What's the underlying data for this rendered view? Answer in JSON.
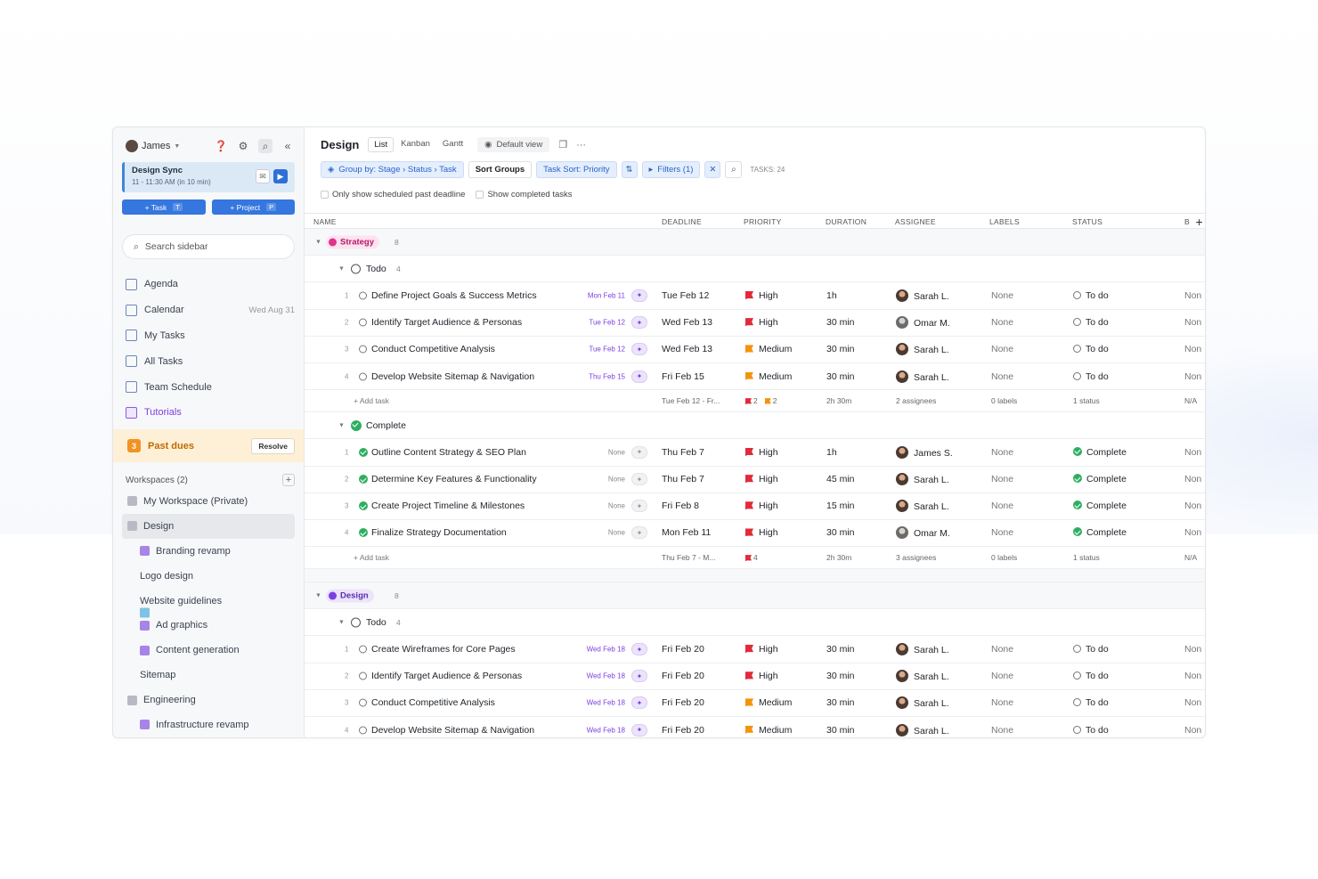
{
  "sidebar": {
    "user": "James",
    "meeting": {
      "title": "Design Sync",
      "time": "11 - 11:30 AM (in 10 min)"
    },
    "task_btn": "+ Task",
    "task_key": "T",
    "project_btn": "+ Project",
    "project_key": "P",
    "search_placeholder": "Search sidebar",
    "nav": [
      {
        "label": "Agenda",
        "extra": ""
      },
      {
        "label": "Calendar",
        "extra": "Wed Aug 31"
      },
      {
        "label": "My Tasks",
        "extra": ""
      },
      {
        "label": "All Tasks",
        "extra": ""
      },
      {
        "label": "Team Schedule",
        "extra": ""
      },
      {
        "label": "Tutorials",
        "extra": ""
      }
    ],
    "past_dues": {
      "count": "3",
      "label": "Past dues",
      "action": "Resolve"
    },
    "workspaces_label": "Workspaces (2)",
    "workspaces": [
      {
        "label": "My Workspace (Private)"
      },
      {
        "label": "Design"
      },
      {
        "label": "Branding revamp"
      },
      {
        "label": "Logo design"
      },
      {
        "label": "Website guidelines"
      },
      {
        "label": "Ad graphics"
      },
      {
        "label": "Content generation"
      },
      {
        "label": "Sitemap"
      },
      {
        "label": "Engineering"
      },
      {
        "label": "Infrastructure revamp"
      }
    ]
  },
  "header": {
    "title": "Design",
    "views": [
      "List",
      "Kanban",
      "Gantt"
    ],
    "default_view": "Default view",
    "group_by": "Group by: Stage › Status › Task",
    "sort_groups": "Sort Groups",
    "task_sort": "Task Sort: Priority",
    "filters": "Filters (1)",
    "task_count": "TASKS: 24",
    "check1": "Only show scheduled past deadline",
    "check2": "Show completed tasks"
  },
  "columns": [
    "NAME",
    "DEADLINE",
    "PRIORITY",
    "DURATION",
    "ASSIGNEE",
    "LABELS",
    "STATUS",
    "B"
  ],
  "groups": [
    {
      "stage": "Strategy",
      "count": "8",
      "subgroups": [
        {
          "status": "Todo",
          "count": "4",
          "tasks": [
            {
              "idx": "1",
              "name": "Define Project Goals & Success Metrics",
              "sched": "Mon Feb 11",
              "deadline": "Tue Feb 12",
              "priority": "High",
              "duration": "1h",
              "assignee": "Sarah L.",
              "labels": "None",
              "status": "To do",
              "extra": "Non"
            },
            {
              "idx": "2",
              "name": "Identify Target Audience & Personas",
              "sched": "Tue Feb 12",
              "deadline": "Wed Feb 13",
              "priority": "High",
              "duration": "30 min",
              "assignee": "Omar M.",
              "labels": "None",
              "status": "To do",
              "extra": "Non"
            },
            {
              "idx": "3",
              "name": "Conduct Competitive Analysis",
              "sched": "Tue Feb 12",
              "deadline": "Wed Feb 13",
              "priority": "Medium",
              "duration": "30 min",
              "assignee": "Sarah L.",
              "labels": "None",
              "status": "To do",
              "extra": "Non"
            },
            {
              "idx": "4",
              "name": "Develop Website Sitemap & Navigation",
              "sched": "Thu Feb 15",
              "deadline": "Fri Feb 15",
              "priority": "Medium",
              "duration": "30 min",
              "assignee": "Sarah L.",
              "labels": "None",
              "status": "To do",
              "extra": "Non"
            }
          ],
          "footer": {
            "add": "+ Add task",
            "deadline": "Tue Feb 12 - Fr...",
            "prio_a": "2",
            "prio_b": "2",
            "duration": "2h 30m",
            "assignees": "2 assignees",
            "labels": "0 labels",
            "status": "1 status",
            "extra": "N/A"
          }
        },
        {
          "status": "Complete",
          "count": "4",
          "tasks": [
            {
              "idx": "1",
              "name": "Outline Content Strategy & SEO Plan",
              "sched": "None",
              "deadline": "Thu Feb 7",
              "priority": "High",
              "duration": "1h",
              "assignee": "James S.",
              "labels": "None",
              "status": "Complete",
              "extra": "Non"
            },
            {
              "idx": "2",
              "name": "Determine Key Features & Functionality",
              "sched": "None",
              "deadline": "Thu Feb 7",
              "priority": "High",
              "duration": "45 min",
              "assignee": "Sarah L.",
              "labels": "None",
              "status": "Complete",
              "extra": "Non"
            },
            {
              "idx": "3",
              "name": "Create Project Timeline & Milestones",
              "sched": "None",
              "deadline": "Fri Feb 8",
              "priority": "High",
              "duration": "15 min",
              "assignee": "Sarah L.",
              "labels": "None",
              "status": "Complete",
              "extra": "Non"
            },
            {
              "idx": "4",
              "name": "Finalize Strategy Documentation",
              "sched": "None",
              "deadline": "Mon Feb 11",
              "priority": "High",
              "duration": "30 min",
              "assignee": "Omar M.",
              "labels": "None",
              "status": "Complete",
              "extra": "Non"
            }
          ],
          "footer": {
            "add": "+ Add task",
            "deadline": "Thu Feb 7 - M...",
            "prio_a": "4",
            "prio_b": "",
            "duration": "2h 30m",
            "assignees": "3 assignees",
            "labels": "0 labels",
            "status": "1 status",
            "extra": "N/A"
          }
        }
      ]
    },
    {
      "stage": "Design",
      "count": "8",
      "subgroups": [
        {
          "status": "Todo",
          "count": "4",
          "tasks": [
            {
              "idx": "1",
              "name": "Create Wireframes for Core Pages",
              "sched": "Wed Feb 18",
              "deadline": "Fri Feb 20",
              "priority": "High",
              "duration": "30 min",
              "assignee": "Sarah L.",
              "labels": "None",
              "status": "To do",
              "extra": "Non"
            },
            {
              "idx": "2",
              "name": "Identify Target Audience & Personas",
              "sched": "Wed Feb 18",
              "deadline": "Fri Feb 20",
              "priority": "High",
              "duration": "30 min",
              "assignee": "Sarah L.",
              "labels": "None",
              "status": "To do",
              "extra": "Non"
            },
            {
              "idx": "3",
              "name": "Conduct Competitive Analysis",
              "sched": "Wed Feb 18",
              "deadline": "Fri Feb 20",
              "priority": "Medium",
              "duration": "30 min",
              "assignee": "Sarah L.",
              "labels": "None",
              "status": "To do",
              "extra": "Non"
            },
            {
              "idx": "4",
              "name": "Develop Website Sitemap & Navigation",
              "sched": "Wed Feb 18",
              "deadline": "Fri Feb 20",
              "priority": "Medium",
              "duration": "30 min",
              "assignee": "Sarah L.",
              "labels": "None",
              "status": "To do",
              "extra": "Non"
            }
          ]
        }
      ]
    }
  ]
}
